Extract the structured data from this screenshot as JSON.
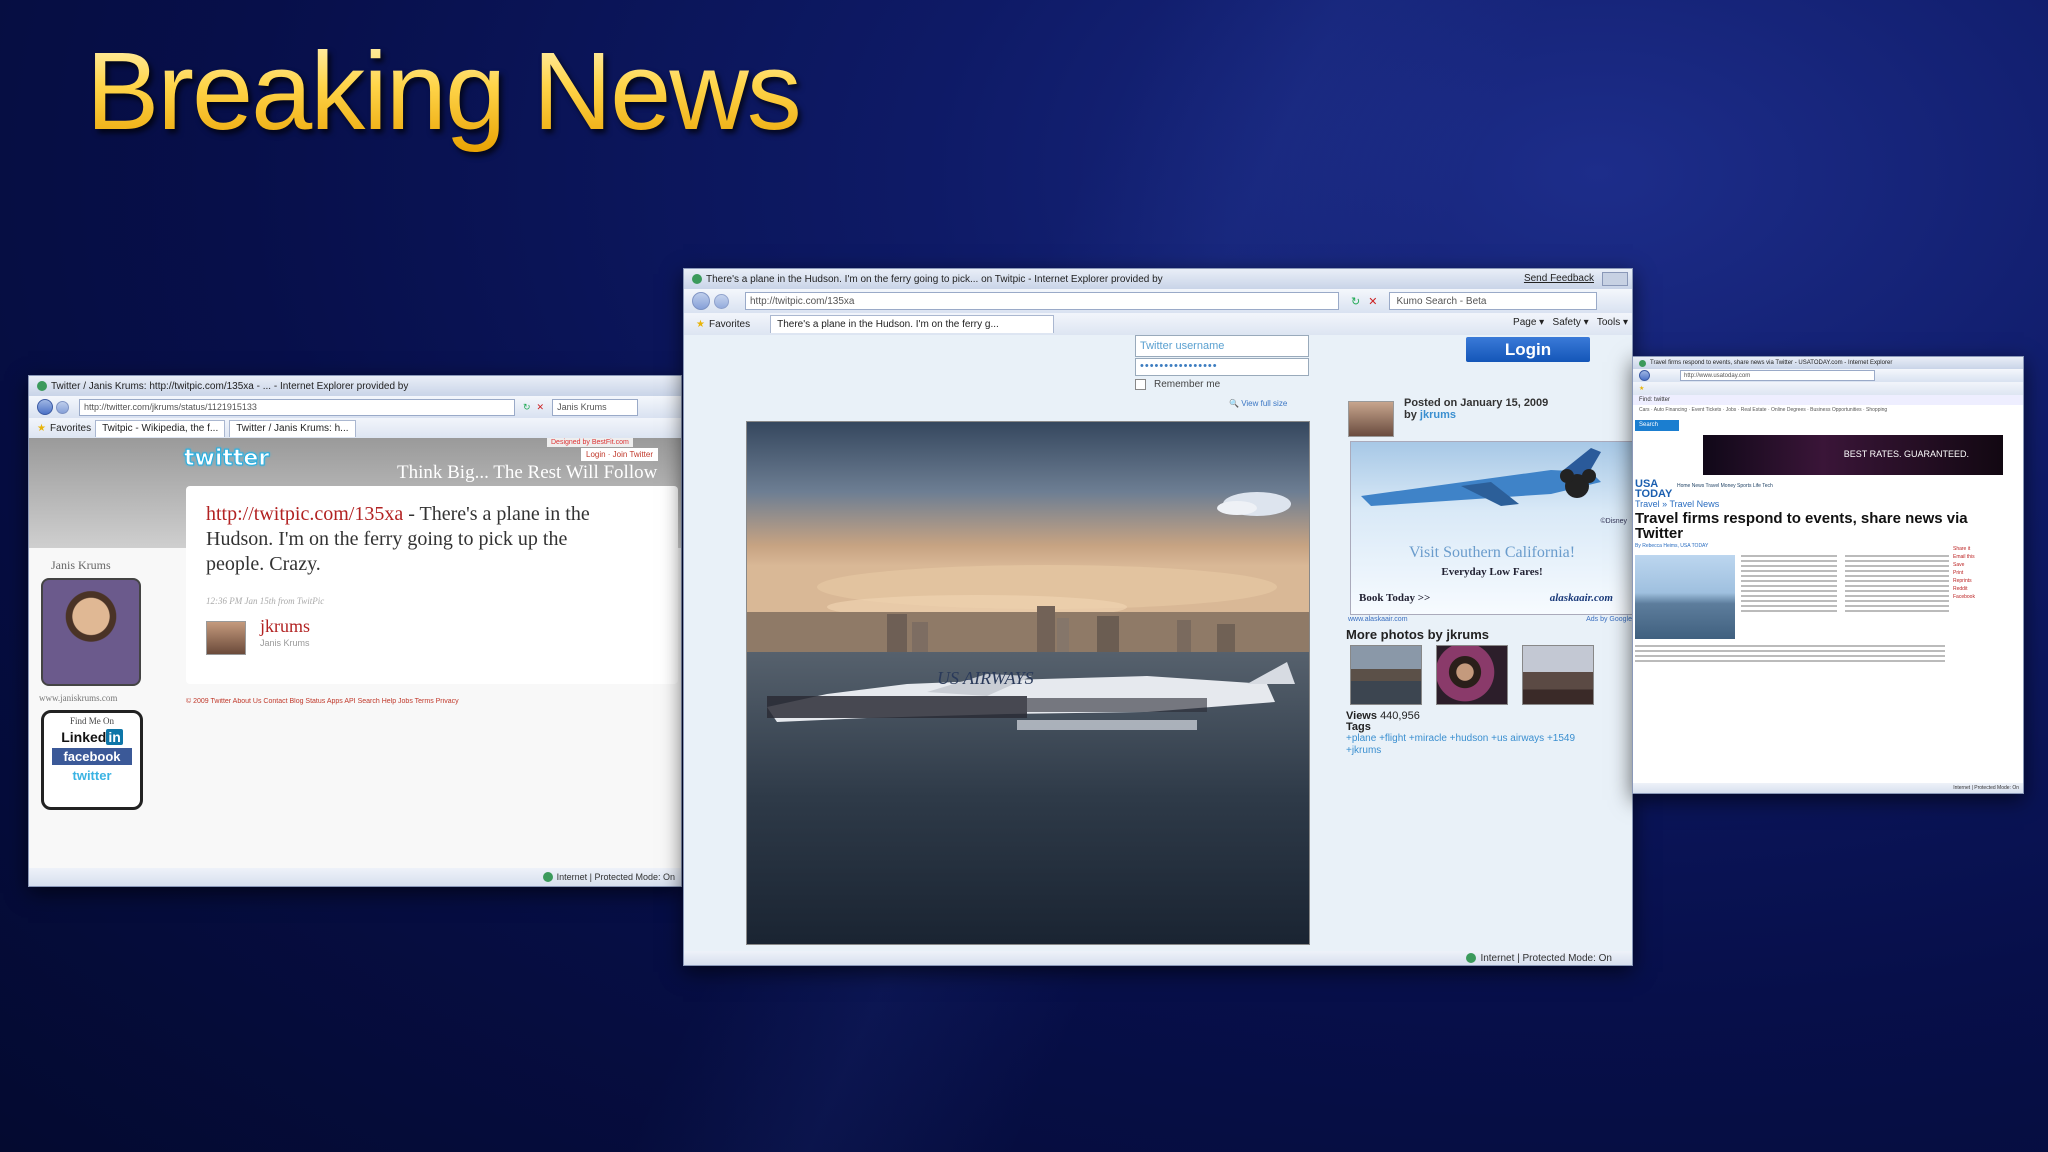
{
  "slide": {
    "title": "Breaking News"
  },
  "twitter_window": {
    "titlebar": "Twitter / Janis Krums: http://twitpic.com/135xa - ... - Internet Explorer provided by",
    "address": "http://twitter.com/jkrums/status/1121915133",
    "search_box": "Janis Krums",
    "favorites": "Favorites",
    "tabs": [
      "Twitpic - Wikipedia, the f...",
      "Twitter / Janis Krums: h..."
    ],
    "designed_badge": "Designed by BestFit.com",
    "logo": "twitter",
    "tagline": "Think Big... The Rest Will Follow",
    "login_links": "Login · Join Twitter",
    "tweet_link": "http://twitpic.com/135xa",
    "tweet_text": " - There's a plane in the Hudson. I'm on the ferry going to pick up the people. Crazy.",
    "tweet_meta": "12:36 PM Jan 15th from TwitPic",
    "user_handle": "jkrums",
    "user_name": "Janis Krums",
    "sidebar_name": "Janis Krums",
    "sidebar_site": "www.janiskrums.com",
    "find_me_heading": "Find Me On",
    "social": {
      "linkedin_a": "Linked",
      "linkedin_b": "in",
      "facebook": "facebook",
      "twitter": "twitter"
    },
    "footer": "© 2009 Twitter   About Us   Contact   Blog   Status   Apps   API   Search   Help   Jobs   Terms   Privacy",
    "status": "Internet | Protected Mode: On"
  },
  "twitpic_window": {
    "titlebar": "There's a plane in the Hudson. I'm on the ferry going to pick... on Twitpic - Internet Explorer provided by",
    "send_feedback": "Send Feedback",
    "address": "http://twitpic.com/135xa",
    "search_box": "Kumo Search - Beta",
    "favorites": "Favorites",
    "tab": "There's a plane in the Hudson. I'm on the ferry g...",
    "commands": [
      "Page ▾",
      "Safety ▾",
      "Tools ▾"
    ],
    "username_placeholder": "Twitter username",
    "password_mask": "••••••••••••••••",
    "remember_me": "Remember me",
    "login_button": "Login",
    "view_full_size": "View full size",
    "posted_on": "Posted on January 15, 2009",
    "posted_by_prefix": "by ",
    "posted_by": "jkrums",
    "ad": {
      "headline": "Visit Southern California!",
      "sub": "Everyday Low Fares!",
      "book": "Book Today >>",
      "brand": "alaskaair.com",
      "disney": "©Disney"
    },
    "ad_url": "www.alaskaair.com",
    "ads_by": "Ads by Google",
    "plane_livery": "US AIRWAYS",
    "more_photos": "More photos by jkrums",
    "views_label": "Views",
    "views_value": "440,956",
    "tags_label": "Tags",
    "tags": "+plane  +flight  +miracle  +hudson  +us airways  +1549  +jkrums",
    "status": "Internet | Protected Mode: On"
  },
  "usatoday_window": {
    "titlebar": "Travel firms respond to events, share news via Twitter - USATODAY.com - Internet Explorer",
    "address": "http://www.usatoday.com",
    "find": "Find: twitter",
    "links": "Cars · Auto Financing · Event Tickets · Jobs · Real Estate · Online Degrees · Business Opportunities · Shopping",
    "search": "Search",
    "banner": "BEST RATES. GUARANTEED.",
    "logo": "USA TODAY",
    "nav": "Home   News   Travel   Money   Sports   Life   Tech",
    "crumb": "Travel » Travel News",
    "headline": "Travel firms respond to events, share news via Twitter",
    "byline": "By Rebecca Heims, USA TODAY",
    "rightcol": [
      "Share it",
      "Email this",
      "Save",
      "Print",
      "Reprints",
      "Reddit",
      "Facebook"
    ],
    "status": "Internet | Protected Mode: On"
  }
}
